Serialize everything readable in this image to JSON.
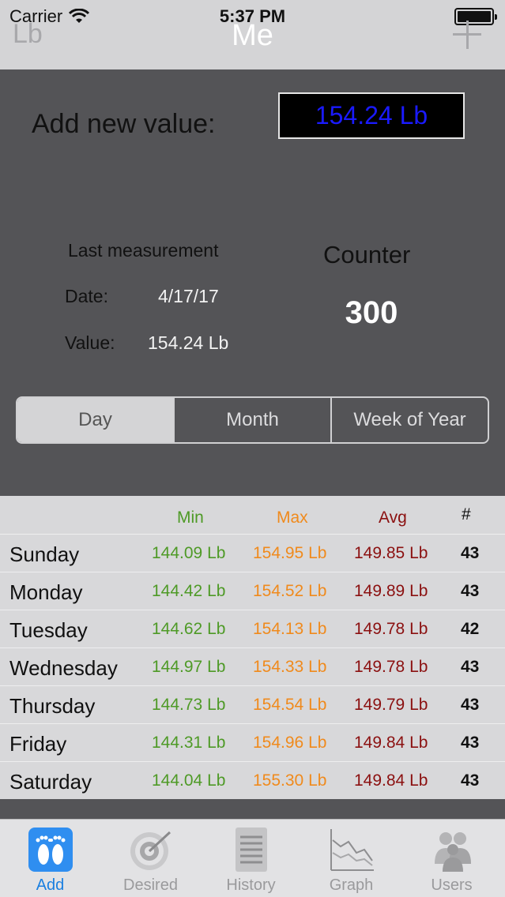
{
  "status": {
    "carrier": "Carrier",
    "time": "5:37 PM"
  },
  "nav": {
    "left": "Lb",
    "title": "Me"
  },
  "add": {
    "label": "Add new value:",
    "value": "154.24 Lb"
  },
  "last": {
    "title": "Last measurement",
    "date_label": "Date:",
    "date_value": "4/17/17",
    "value_label": "Value:",
    "value_value": "154.24 Lb"
  },
  "counter": {
    "title": "Counter",
    "value": "300"
  },
  "segments": [
    "Day",
    "Month",
    "Week of Year"
  ],
  "table": {
    "headers": {
      "min": "Min",
      "max": "Max",
      "avg": "Avg",
      "count": "#"
    },
    "rows": [
      {
        "day": "Sunday",
        "min": "144.09 Lb",
        "max": "154.95 Lb",
        "avg": "149.85 Lb",
        "count": "43"
      },
      {
        "day": "Monday",
        "min": "144.42 Lb",
        "max": "154.52 Lb",
        "avg": "149.89 Lb",
        "count": "43"
      },
      {
        "day": "Tuesday",
        "min": "144.62 Lb",
        "max": "154.13 Lb",
        "avg": "149.78 Lb",
        "count": "42"
      },
      {
        "day": "Wednesday",
        "min": "144.97 Lb",
        "max": "154.33 Lb",
        "avg": "149.78 Lb",
        "count": "43"
      },
      {
        "day": "Thursday",
        "min": "144.73 Lb",
        "max": "154.54 Lb",
        "avg": "149.79 Lb",
        "count": "43"
      },
      {
        "day": "Friday",
        "min": "144.31 Lb",
        "max": "154.96 Lb",
        "avg": "149.84 Lb",
        "count": "43"
      },
      {
        "day": "Saturday",
        "min": "144.04 Lb",
        "max": "155.30 Lb",
        "avg": "149.84 Lb",
        "count": "43"
      }
    ]
  },
  "tabs": [
    {
      "label": "Add",
      "icon": "footprints-icon",
      "active": true
    },
    {
      "label": "Desired",
      "icon": "target-icon",
      "active": false
    },
    {
      "label": "History",
      "icon": "list-icon",
      "active": false
    },
    {
      "label": "Graph",
      "icon": "graph-icon",
      "active": false
    },
    {
      "label": "Users",
      "icon": "users-icon",
      "active": false
    }
  ],
  "colors": {
    "min": "#4e9a26",
    "max": "#f08a1c",
    "avg": "#8b1010",
    "accent": "#1a7fe0"
  }
}
